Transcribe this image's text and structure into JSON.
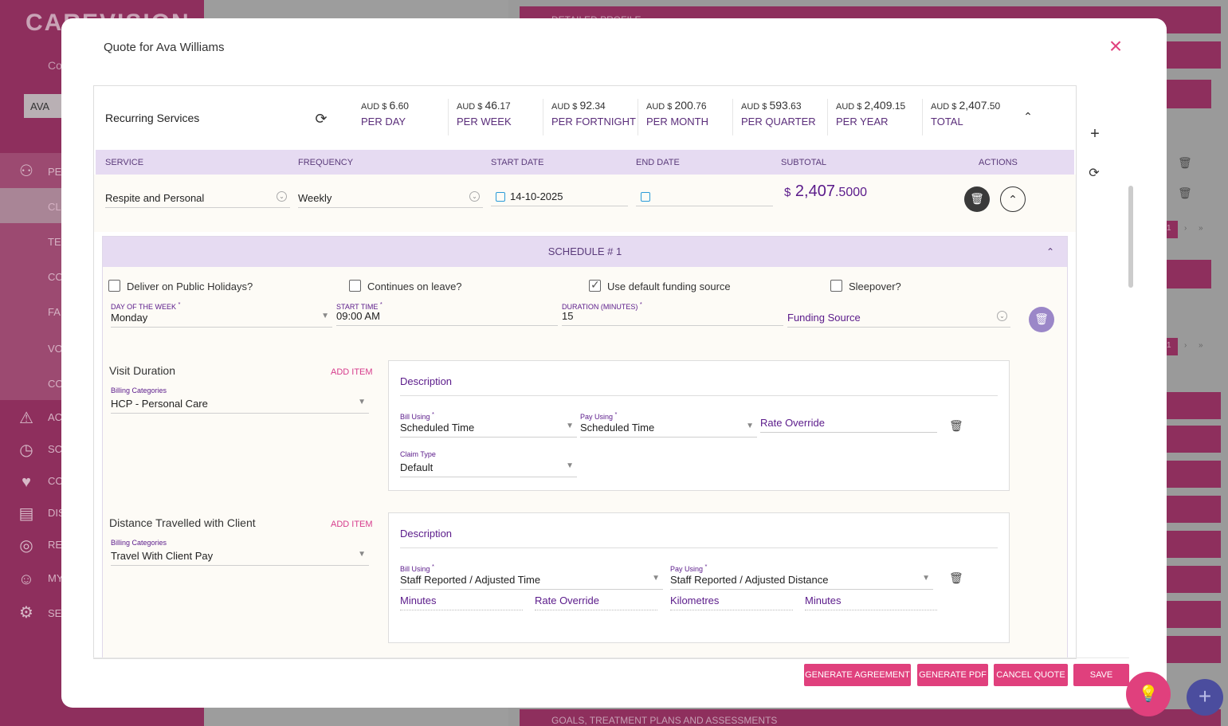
{
  "background": {
    "logo": "CAREVISION",
    "company_short": "Co",
    "user_chip": "AVA",
    "nav": [
      "PE",
      "CL",
      "TE",
      "CO",
      "FA",
      "VO",
      "CO",
      "AC",
      "SC",
      "CO",
      "DIS",
      "RE",
      "MY",
      "SE"
    ],
    "bars": [
      "DETAILED PROFILE",
      "GOALS, TREATMENT PLANS AND ASSESSMENTS"
    ],
    "pager_page": "1",
    "pager_next": "›",
    "pager_last": "»"
  },
  "modal": {
    "title": "Quote for Ava Williams",
    "close_glyph": "×"
  },
  "recurring": {
    "title": "Recurring Services",
    "currency_prefix": "AUD $",
    "stats": [
      {
        "int": "6",
        "dec": ".60",
        "label": "PER DAY"
      },
      {
        "int": "46",
        "dec": ".17",
        "label": "PER WEEK"
      },
      {
        "int": "92",
        "dec": ".34",
        "label": "PER FORTNIGHT"
      },
      {
        "int": "200",
        "dec": ".76",
        "label": "PER MONTH"
      },
      {
        "int": "593",
        "dec": ".63",
        "label": "PER QUARTER"
      },
      {
        "int": "2,409",
        "dec": ".15",
        "label": "PER YEAR"
      },
      {
        "int": "2,407",
        "dec": ".50",
        "label": "TOTAL"
      }
    ]
  },
  "columns": {
    "service": "SERVICE",
    "frequency": "FREQUENCY",
    "start_date": "START DATE",
    "end_date": "END DATE",
    "subtotal": "SUBTOTAL",
    "actions": "ACTIONS"
  },
  "service_row": {
    "service": "Respite and Personal",
    "frequency": "Weekly",
    "start_date": "14-10-2025",
    "end_date": "",
    "subtotal_currency": "$",
    "subtotal_int": "2,407",
    "subtotal_dec": ".5000"
  },
  "schedule": {
    "title": "SCHEDULE # 1",
    "checkboxes": [
      {
        "label": "Deliver on Public Holidays?",
        "checked": false
      },
      {
        "label": "Continues on leave?",
        "checked": false
      },
      {
        "label": "Use default funding source",
        "checked": true
      },
      {
        "label": "Sleepover?",
        "checked": false
      }
    ],
    "required_mark": "*",
    "day_label": "DAY OF THE WEEK",
    "day_value": "Monday",
    "start_time_label": "START TIME",
    "start_time_value": "09:00 AM",
    "duration_label": "DURATION (MINUTES)",
    "duration_value": "15",
    "funding_placeholder": "Funding Source"
  },
  "visit_duration": {
    "title": "Visit Duration",
    "add_item": "ADD ITEM",
    "billing_label": "Billing Categories",
    "billing_value": "HCP - Personal Care",
    "description_placeholder": "Description",
    "bill_using_label": "Bill Using",
    "bill_using_value": "Scheduled Time",
    "pay_using_label": "Pay Using",
    "pay_using_value": "Scheduled Time",
    "rate_override": "Rate Override",
    "claim_type_label": "Claim Type",
    "claim_type_value": "Default"
  },
  "distance": {
    "title": "Distance Travelled with Client",
    "add_item": "ADD ITEM",
    "billing_label": "Billing Categories",
    "billing_value": "Travel With Client Pay",
    "description_placeholder": "Description",
    "bill_using_label": "Bill Using",
    "bill_using_value": "Staff Reported / Adjusted Time",
    "pay_using_label": "Pay Using",
    "pay_using_value": "Staff Reported / Adjusted Distance",
    "minutes_1": "Minutes",
    "rate_override": "Rate Override",
    "kilometres": "Kilometres",
    "minutes_2": "Minutes"
  },
  "footer": {
    "generate_agreement": "GENERATE AGREEMENT",
    "generate_pdf": "GENERATE PDF",
    "cancel_quote": "CANCEL QUOTE",
    "save": "SAVE"
  },
  "colors": {
    "brand_pink": "#e0407d",
    "brand_purple": "#5a1a8a",
    "header_lavender": "#e6dbf2",
    "sidebar_bg": "#8e2f5d"
  }
}
